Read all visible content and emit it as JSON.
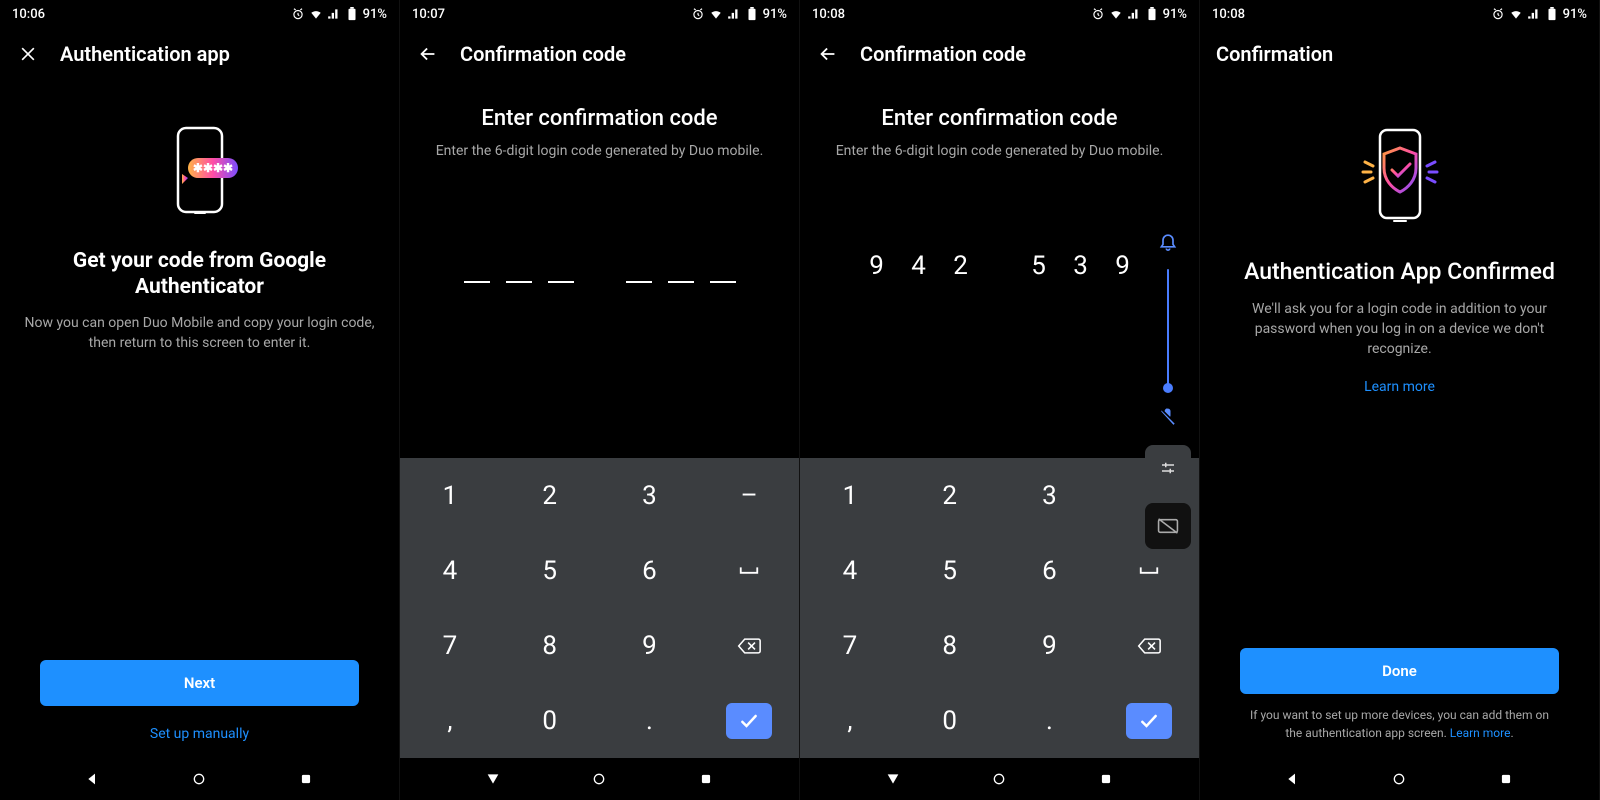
{
  "status": {
    "battery": "91%"
  },
  "screen1": {
    "time": "10:06",
    "title": "Authentication app",
    "heading": "Get your code from Google Authenticator",
    "sub": "Now you can open Duo Mobile and copy your login code, then return to this screen to enter it.",
    "next": "Next",
    "manual": "Set up manually"
  },
  "screen2": {
    "time": "10:07",
    "title": "Confirmation code",
    "heading": "Enter confirmation code",
    "sub": "Enter the 6-digit login code generated by Duo mobile.",
    "keys": {
      "r1": [
        "1",
        "2",
        "3",
        "–"
      ],
      "r2": [
        "4",
        "5",
        "6",
        "⌴"
      ],
      "r3": [
        "7",
        "8",
        "9",
        "⌫"
      ],
      "r4": [
        ",",
        "0",
        ".",
        "✓"
      ]
    }
  },
  "screen3": {
    "time": "10:08",
    "title": "Confirmation code",
    "heading": "Enter confirmation code",
    "sub": "Enter the 6-digit login code generated by Duo mobile.",
    "code": [
      "9",
      "4",
      "2",
      "5",
      "3",
      "9"
    ]
  },
  "screen4": {
    "time": "10:08",
    "title": "Confirmation",
    "heading": "Authentication App Confirmed",
    "sub": "We'll ask you for a login code in addition to your password when you log in on a device we don't recognize.",
    "learn": "Learn more",
    "done": "Done",
    "footer_a": "If you want to set up more devices, you can add them on the authentication app screen. ",
    "footer_b": "Learn more"
  }
}
